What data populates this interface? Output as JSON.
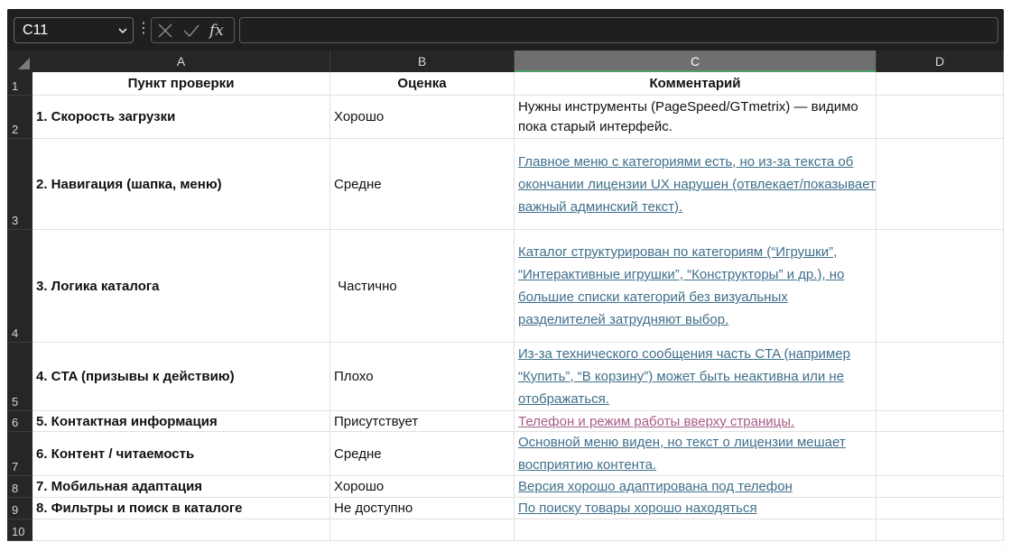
{
  "formula_bar": {
    "name_box": "C11",
    "fx_label": "fx",
    "formula": ""
  },
  "columns": [
    "A",
    "B",
    "C",
    "D"
  ],
  "rows": [
    {
      "num": "1",
      "a": "Пункт проверки",
      "b": "Оценка",
      "c": "Комментарий",
      "c_style": "header"
    },
    {
      "num": "2",
      "a": "1. Скорость загрузки",
      "b": "Хорошо",
      "c": "Нужны инструменты (PageSpeed/GTmetrix) — видимо пока старый интерфейс.",
      "c_style": "plain"
    },
    {
      "num": "3",
      "a": "2. Навигация (шапка, меню)",
      "b": "Средне",
      "c": "Главное меню с категориями есть, но из-за текста об окончании лицензии UX нарушен (отвлекает/показывает важный админский текст).",
      "c_style": "link"
    },
    {
      "num": "4",
      "a": "3. Логика каталога",
      "b": " Частично",
      "c": "Каталог структурирован по категориям (“Игрушки”, “Интерактивные игрушки”, “Конструкторы” и др.), но большие списки категорий без визуальных разделителей затрудняют выбор. ",
      "c_style": "link"
    },
    {
      "num": "5",
      "a": "4. CTA (призывы к действию)",
      "b": "Плохо",
      "c": "Из-за технического сообщения часть CTA (например “Купить”, “В корзину”) может быть неактивна или не отображаться.",
      "c_style": "link"
    },
    {
      "num": "6",
      "a": "5. Контактная информация",
      "b": "Присутствует",
      "c": "Телефон и режим работы вверху страницы. ",
      "c_style": "pink"
    },
    {
      "num": "7",
      "a": "6. Контент / читаемость",
      "b": "Средне",
      "c": "Основной меню виден, но текст о лицензии мешает восприятию контента. ",
      "c_style": "link"
    },
    {
      "num": "8",
      "a": "7. Мобильная адаптация",
      "b": "Хорошо",
      "c": "Версия хорошо адаптирована под телефон",
      "c_style": "link"
    },
    {
      "num": "9",
      "a": "8. Фильтры и поиск в каталоге",
      "b": "Не доступно",
      "c": "По поиску товары хорошо находяться ",
      "c_style": "link"
    },
    {
      "num": "10",
      "a": "",
      "b": "",
      "c": "",
      "c_style": "plain"
    }
  ],
  "colors": {
    "link": "#3f6f8c",
    "link_pink": "#a75e86",
    "selected_column_underline": "#4ea06a",
    "chrome_dark": "#1f1f1f"
  }
}
